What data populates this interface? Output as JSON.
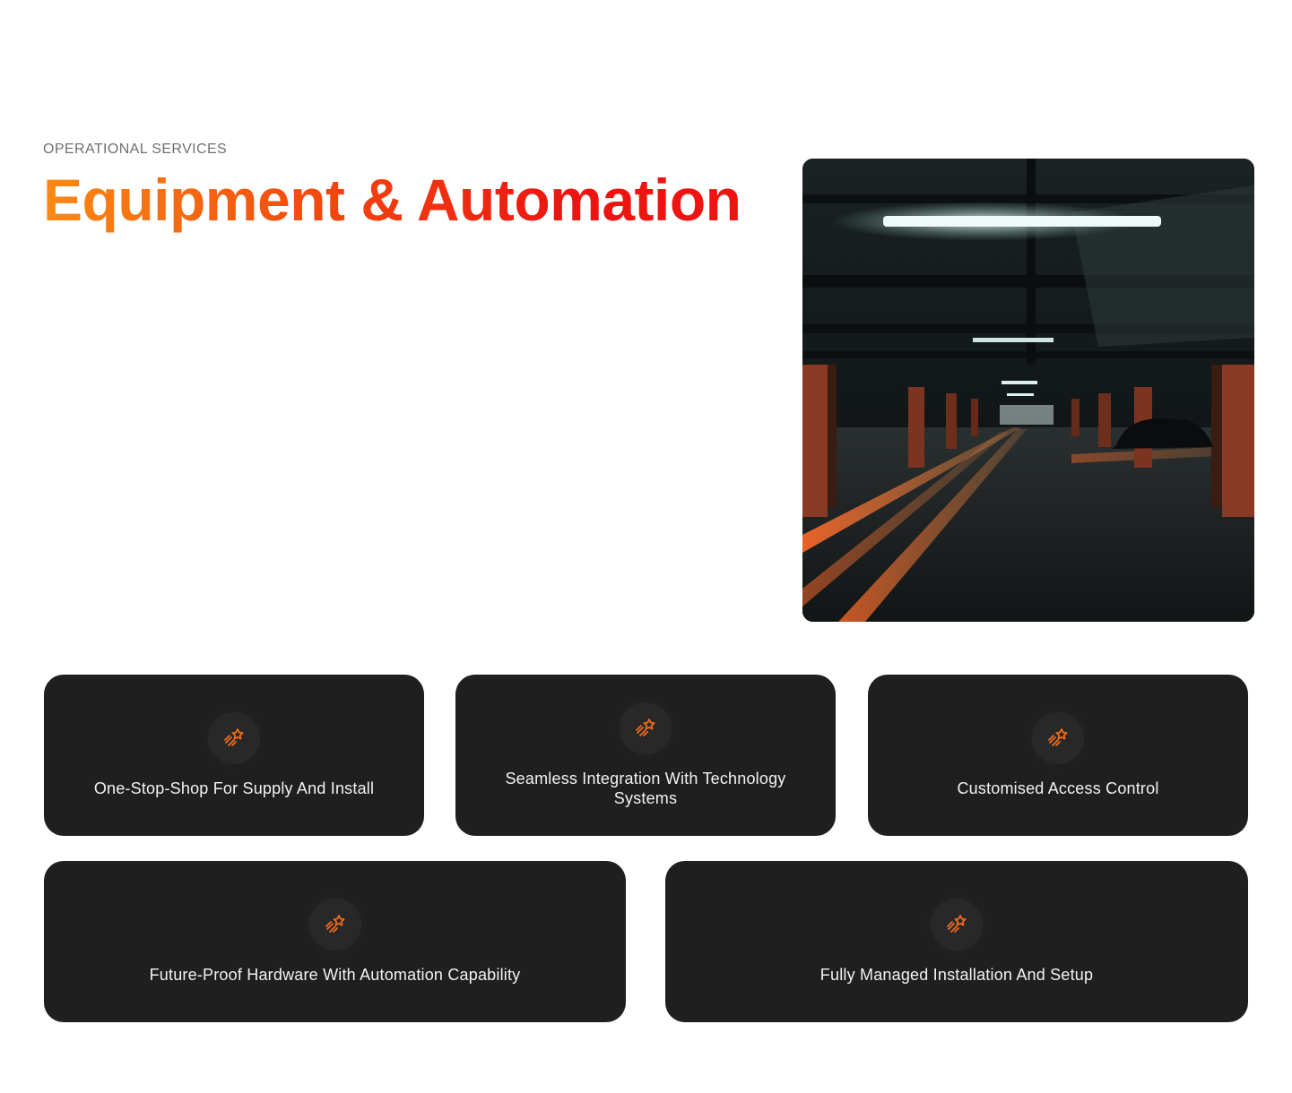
{
  "section": {
    "eyebrow": "OPERATIONAL SERVICES",
    "title": "Equipment & Automation",
    "title_gradient": [
      "#f98a14",
      "#ee1412"
    ]
  },
  "image": {
    "subject": "underground parking garage with orange light streaks"
  },
  "features": [
    {
      "label": "One-Stop-Shop For Supply And Install",
      "icon": "shooting-star-icon"
    },
    {
      "label": "Seamless Integration With Technology Systems",
      "icon": "shooting-star-icon"
    },
    {
      "label": "Customised Access Control",
      "icon": "shooting-star-icon"
    },
    {
      "label": "Future-Proof Hardware With Automation Capability",
      "icon": "shooting-star-icon"
    },
    {
      "label": "Fully Managed Installation And Setup",
      "icon": "shooting-star-icon"
    }
  ],
  "colors": {
    "card_bg": "#1f1f20",
    "icon_accent": "#f26a1b",
    "eyebrow": "#6f6f6f"
  }
}
